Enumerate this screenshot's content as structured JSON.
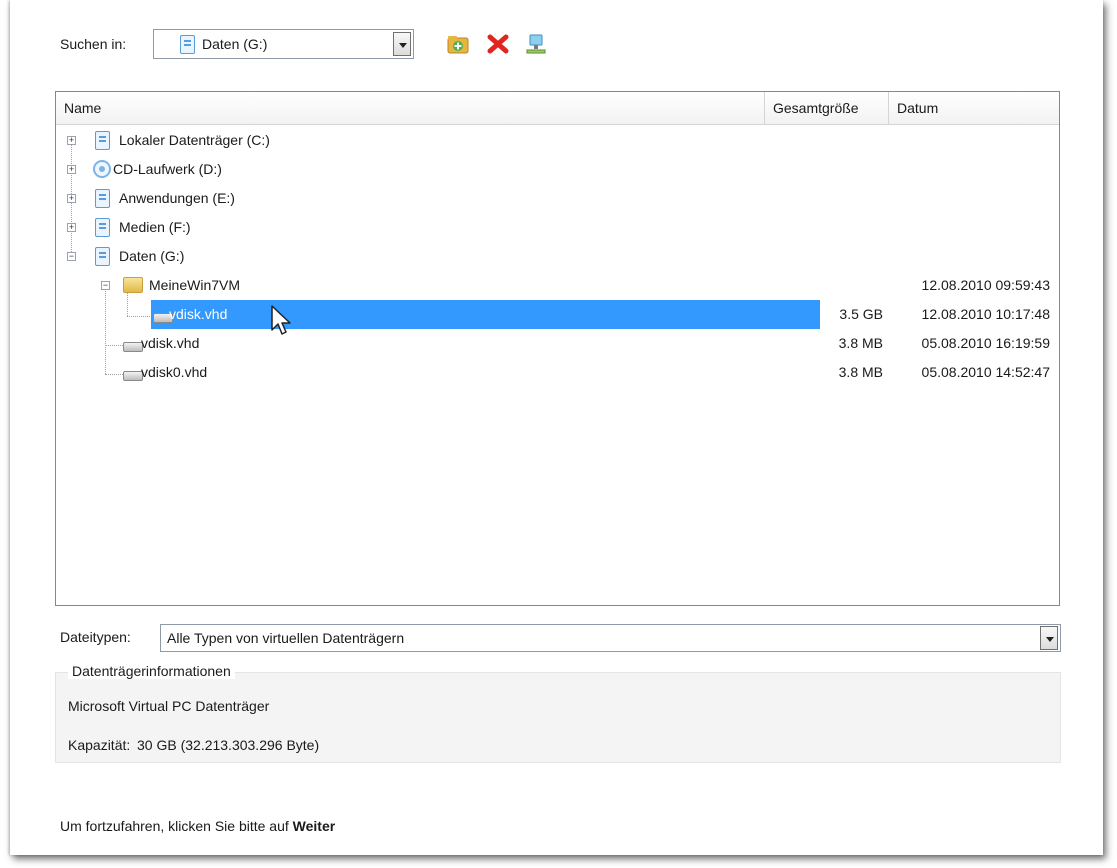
{
  "look_in": {
    "label": "Suchen in:",
    "value": "Daten (G:)"
  },
  "toolbar": {
    "icons": [
      "new-folder-icon",
      "delete-icon",
      "network-icon"
    ]
  },
  "columns": {
    "name": "Name",
    "size": "Gesamtgröße",
    "date": "Datum"
  },
  "tree": [
    {
      "label": "Lokaler Datenträger (C:)",
      "type": "drive",
      "expander": "+"
    },
    {
      "label": "CD-Laufwerk (D:)",
      "type": "cd",
      "expander": "+"
    },
    {
      "label": "Anwendungen (E:)",
      "type": "drive",
      "expander": "+"
    },
    {
      "label": "Medien (F:)",
      "type": "drive",
      "expander": "+"
    },
    {
      "label": "Daten (G:)",
      "type": "drive",
      "expander": "−"
    },
    {
      "label": "MeineWin7VM",
      "type": "folder",
      "expander": "−",
      "size": "",
      "date": "12.08.2010 09:59:43"
    },
    {
      "label": "vdisk.vhd",
      "type": "file",
      "size": "3.5 GB",
      "date": "12.08.2010 10:17:48",
      "selected": true
    },
    {
      "label": "vdisk.vhd",
      "type": "file",
      "size": "3.8 MB",
      "date": "05.08.2010 16:19:59"
    },
    {
      "label": "vdisk0.vhd",
      "type": "file",
      "size": "3.8 MB",
      "date": "05.08.2010 14:52:47"
    }
  ],
  "file_types": {
    "label": "Dateitypen:",
    "value": "Alle Typen von virtuellen Datenträgern"
  },
  "disk_info": {
    "title": "Datenträgerinformationen",
    "type_line": "Microsoft Virtual PC Datenträger",
    "capacity_label": "Kapazität:",
    "capacity_value": "30 GB (32.213.303.296 Byte)"
  },
  "footer": {
    "prefix": "Um fortzufahren, klicken Sie bitte auf ",
    "bold": "Weiter"
  },
  "colors": {
    "selection": "#3399ff",
    "drive_blue": "#5a9bd8"
  }
}
